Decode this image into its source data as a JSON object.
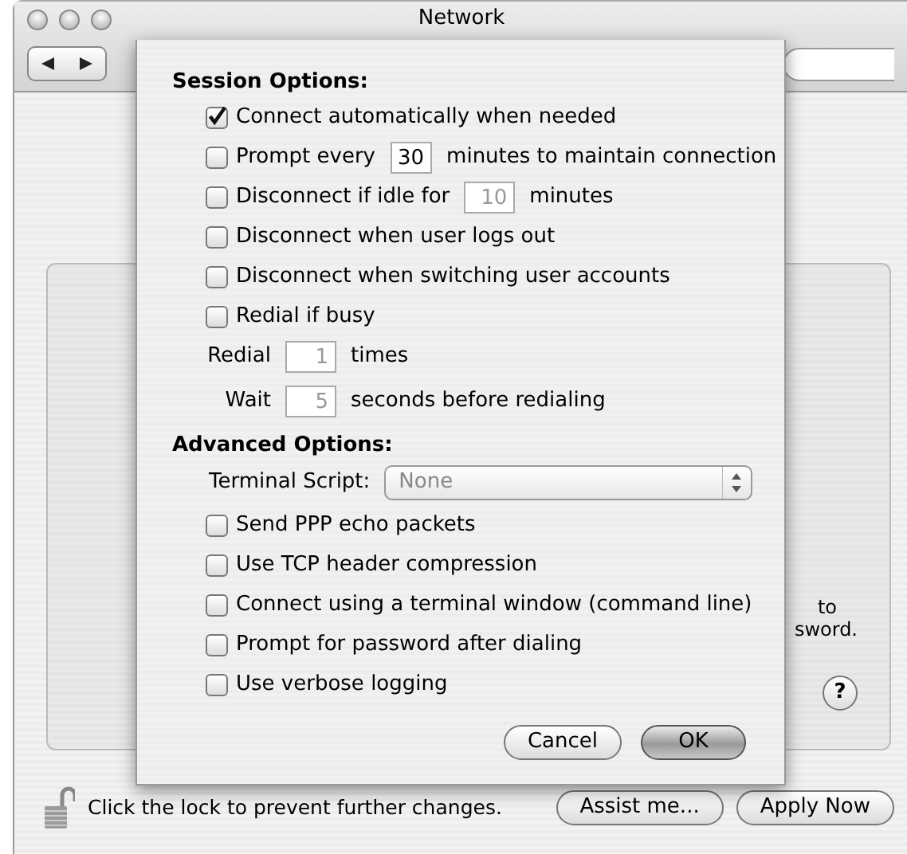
{
  "window": {
    "title": "Network"
  },
  "sheet": {
    "session_title": "Session Options:",
    "session_options": [
      {
        "kind": "checkbox",
        "label": "Connect automatically when needed",
        "checked": true
      },
      {
        "kind": "checkbox-field",
        "label": "Prompt every",
        "value": "30",
        "after": "minutes to maintain connection",
        "checked": false,
        "disabled": false
      },
      {
        "kind": "checkbox-field",
        "label": "Disconnect if idle for",
        "value": "10",
        "after": "minutes",
        "checked": false,
        "disabled": true
      },
      {
        "kind": "checkbox",
        "label": "Disconnect when user logs out",
        "checked": false
      },
      {
        "kind": "checkbox",
        "label": "Disconnect when switching user accounts",
        "checked": false
      },
      {
        "kind": "checkbox",
        "label": "Redial if busy",
        "checked": false
      }
    ],
    "redial": [
      {
        "label": "Redial",
        "value": "1",
        "unit": "times",
        "disabled": true
      },
      {
        "label": "Wait",
        "value": "5",
        "unit": "seconds before redialing",
        "disabled": true
      }
    ],
    "advanced_title": "Advanced Options:",
    "terminal_script": {
      "label": "Terminal Script:",
      "value": "None",
      "disabled": true
    },
    "advanced_options": [
      {
        "label": "Send PPP echo packets",
        "checked": false
      },
      {
        "label": "Use TCP header compression",
        "checked": false
      },
      {
        "label": "Connect using a terminal window (command line)",
        "checked": false
      },
      {
        "label": "Prompt for password after dialing",
        "checked": false
      },
      {
        "label": "Use verbose logging",
        "checked": false
      }
    ],
    "buttons": [
      {
        "label": "Cancel",
        "default": false
      },
      {
        "label": "OK",
        "default": true
      }
    ]
  },
  "panel": {
    "fragments": [
      "to",
      "sword."
    ],
    "help": "?"
  },
  "footer": {
    "lock_text": "Click the lock to prevent further changes.",
    "locked": false,
    "buttons": [
      "Assist me...",
      "Apply Now"
    ]
  }
}
